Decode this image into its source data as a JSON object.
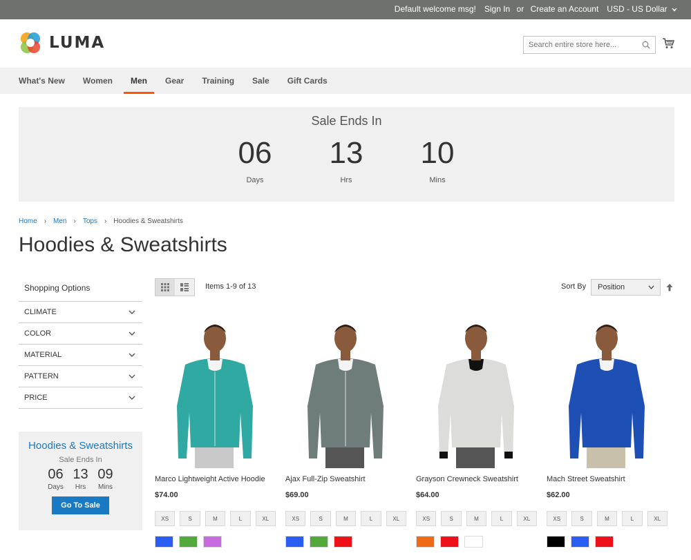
{
  "topbar": {
    "welcome": "Default welcome msg!",
    "sign_in": "Sign In",
    "or": "or",
    "create_account": "Create an Account",
    "currency": "USD - US Dollar"
  },
  "header": {
    "logo_text": "LUMA",
    "search_placeholder": "Search entire store here..."
  },
  "nav": {
    "items": [
      "What's New",
      "Women",
      "Men",
      "Gear",
      "Training",
      "Sale",
      "Gift Cards"
    ],
    "active": "Men"
  },
  "banner": {
    "title": "Sale Ends In",
    "units": [
      {
        "value": "06",
        "label": "Days"
      },
      {
        "value": "13",
        "label": "Hrs"
      },
      {
        "value": "10",
        "label": "Mins"
      }
    ]
  },
  "breadcrumbs": [
    "Home",
    "Men",
    "Tops",
    "Hoodies & Sweatshirts"
  ],
  "page_title": "Hoodies & Sweatshirts",
  "sidebar": {
    "title": "Shopping Options",
    "filters": [
      "CLIMATE",
      "COLOR",
      "MATERIAL",
      "PATTERN",
      "PRICE"
    ]
  },
  "promo": {
    "title": "Hoodies & Sweatshirts",
    "subtitle": "Sale Ends In",
    "units": [
      {
        "value": "06",
        "label": "Days"
      },
      {
        "value": "13",
        "label": "Hrs"
      },
      {
        "value": "09",
        "label": "Mins"
      }
    ],
    "button": "Go To Sale"
  },
  "toolbar": {
    "items_text": "Items 1-9 of 13",
    "sort_label": "Sort By",
    "sort_value": "Position"
  },
  "colors": {
    "accent": "#1979c3",
    "nav_active": "#ff5501",
    "topbar": "#6e716e"
  },
  "products": [
    {
      "name": "Marco Lightweight Active Hoodie",
      "price": "$74.00",
      "sizes": [
        "XS",
        "S",
        "M",
        "L",
        "XL"
      ],
      "swatches": [
        "#2a5ef2",
        "#53a93b",
        "#c86bde"
      ],
      "garment": "#2fa9a1"
    },
    {
      "name": "Ajax Full-Zip Sweatshirt",
      "price": "$69.00",
      "sizes": [
        "XS",
        "S",
        "M",
        "L",
        "XL"
      ],
      "swatches": [
        "#2a5ef2",
        "#53a93b",
        "#ef1119"
      ],
      "garment": "#6e7c7a"
    },
    {
      "name": "Grayson Crewneck Sweatshirt",
      "price": "$64.00",
      "sizes": [
        "XS",
        "S",
        "M",
        "L",
        "XL"
      ],
      "swatches": [
        "#ef6a14",
        "#ef1119",
        "#ffffff"
      ],
      "garment": "#dcdcda"
    },
    {
      "name": "Mach Street Sweatshirt",
      "price": "$62.00",
      "sizes": [
        "XS",
        "S",
        "M",
        "L",
        "XL"
      ],
      "swatches": [
        "#000000",
        "#2a5ef2",
        "#ef1119"
      ],
      "garment": "#1e4fb5"
    }
  ]
}
